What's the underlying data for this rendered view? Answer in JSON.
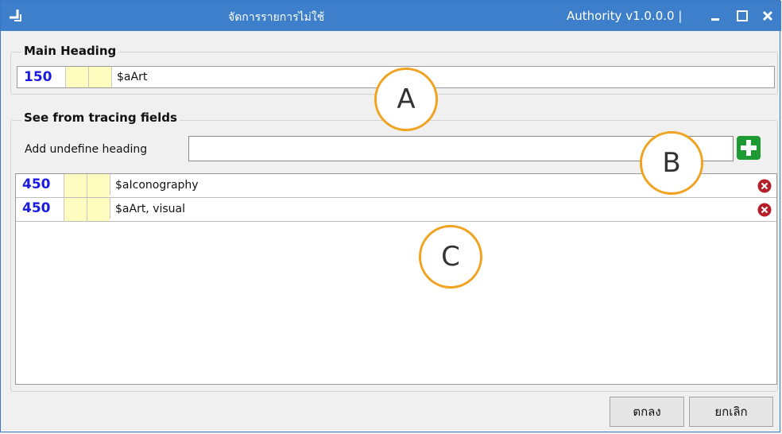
{
  "window": {
    "title": "จัดการรายการไม่ใช้",
    "app_version": "Authority v1.0.0.0 |"
  },
  "main_heading": {
    "legend": "Main Heading",
    "field": {
      "tag": "150",
      "ind1": "",
      "ind2": "",
      "value": "$aArt"
    }
  },
  "see_from": {
    "legend": "See from tracing fields",
    "add_label": "Add undefine heading",
    "add_input_value": "",
    "rows": [
      {
        "tag": "450",
        "ind1": "",
        "ind2": "",
        "value": "$aIconography"
      },
      {
        "tag": "450",
        "ind1": "",
        "ind2": "",
        "value": "$aArt, visual"
      }
    ]
  },
  "callouts": {
    "a": "A",
    "b": "B",
    "c": "C"
  },
  "footer": {
    "ok_label": "ตกลง",
    "cancel_label": "ยกเลิก"
  },
  "colors": {
    "titlebar": "#3e7fcb",
    "callout_ring": "#f0a320",
    "tag_text": "#1a1ae0",
    "indicator_bg": "#fffcbf",
    "add_button": "#1d9a32",
    "delete_icon": "#b3202a"
  },
  "icons": {
    "app": "app-icon",
    "minimize": "minimize-icon",
    "maximize": "maximize-icon",
    "close": "close-icon",
    "add": "plus-icon",
    "delete": "delete-icon"
  }
}
